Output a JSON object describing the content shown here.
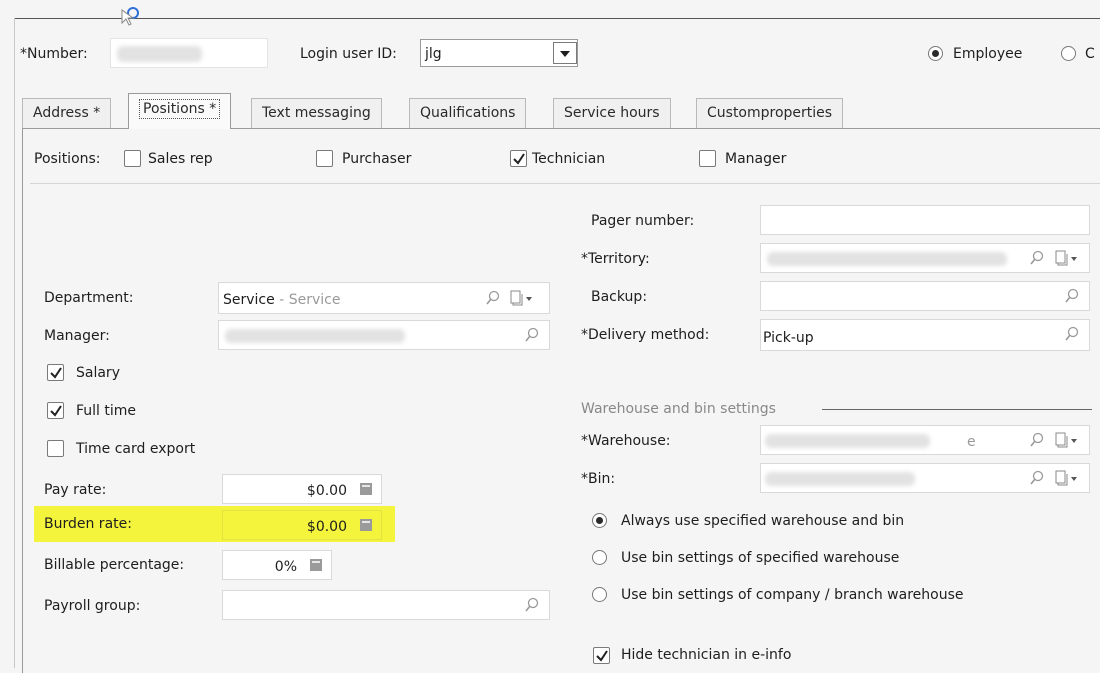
{
  "header": {
    "number_label": "*Number:",
    "login_label": "Login user ID:",
    "login_value": "jlg",
    "employee_label": "Employee",
    "other_label": "C"
  },
  "tabs": [
    {
      "label": "Address *"
    },
    {
      "label": "Positions *"
    },
    {
      "label": "Text messaging"
    },
    {
      "label": "Qualifications"
    },
    {
      "label": "Service hours"
    },
    {
      "label": "Customproperties"
    }
  ],
  "positions": {
    "label": "Positions:",
    "sales_rep": "Sales rep",
    "purchaser": "Purchaser",
    "technician": "Technician",
    "manager": "Manager"
  },
  "left": {
    "department_label": "Department:",
    "department_value": "Service",
    "department_desc": "- Service",
    "manager_label": "Manager:",
    "salary_label": "Salary",
    "full_time_label": "Full time",
    "time_card_label": "Time card export",
    "pay_rate_label": "Pay rate:",
    "pay_rate_value": "$0.00",
    "burden_rate_label": "Burden rate:",
    "burden_rate_value": "$0.00",
    "billable_label": "Billable percentage:",
    "billable_value": "0%",
    "payroll_label": "Payroll group:"
  },
  "right": {
    "pager_label": "Pager number:",
    "territory_label": "*Territory:",
    "backup_label": "Backup:",
    "delivery_label": "*Delivery method:",
    "delivery_value": "Pick-up",
    "wh_group_label": "Warehouse and bin settings",
    "warehouse_label": "*Warehouse:",
    "warehouse_tail": "e",
    "bin_label": "*Bin:",
    "radio1": "Always use specified warehouse and bin",
    "radio2": "Use bin settings of specified warehouse",
    "radio3": "Use bin settings of company / branch warehouse",
    "hide_tech_label": "Hide technician in e-info"
  },
  "colors": {
    "highlight": "#f4f43c",
    "panel": "#f5f5f5"
  }
}
